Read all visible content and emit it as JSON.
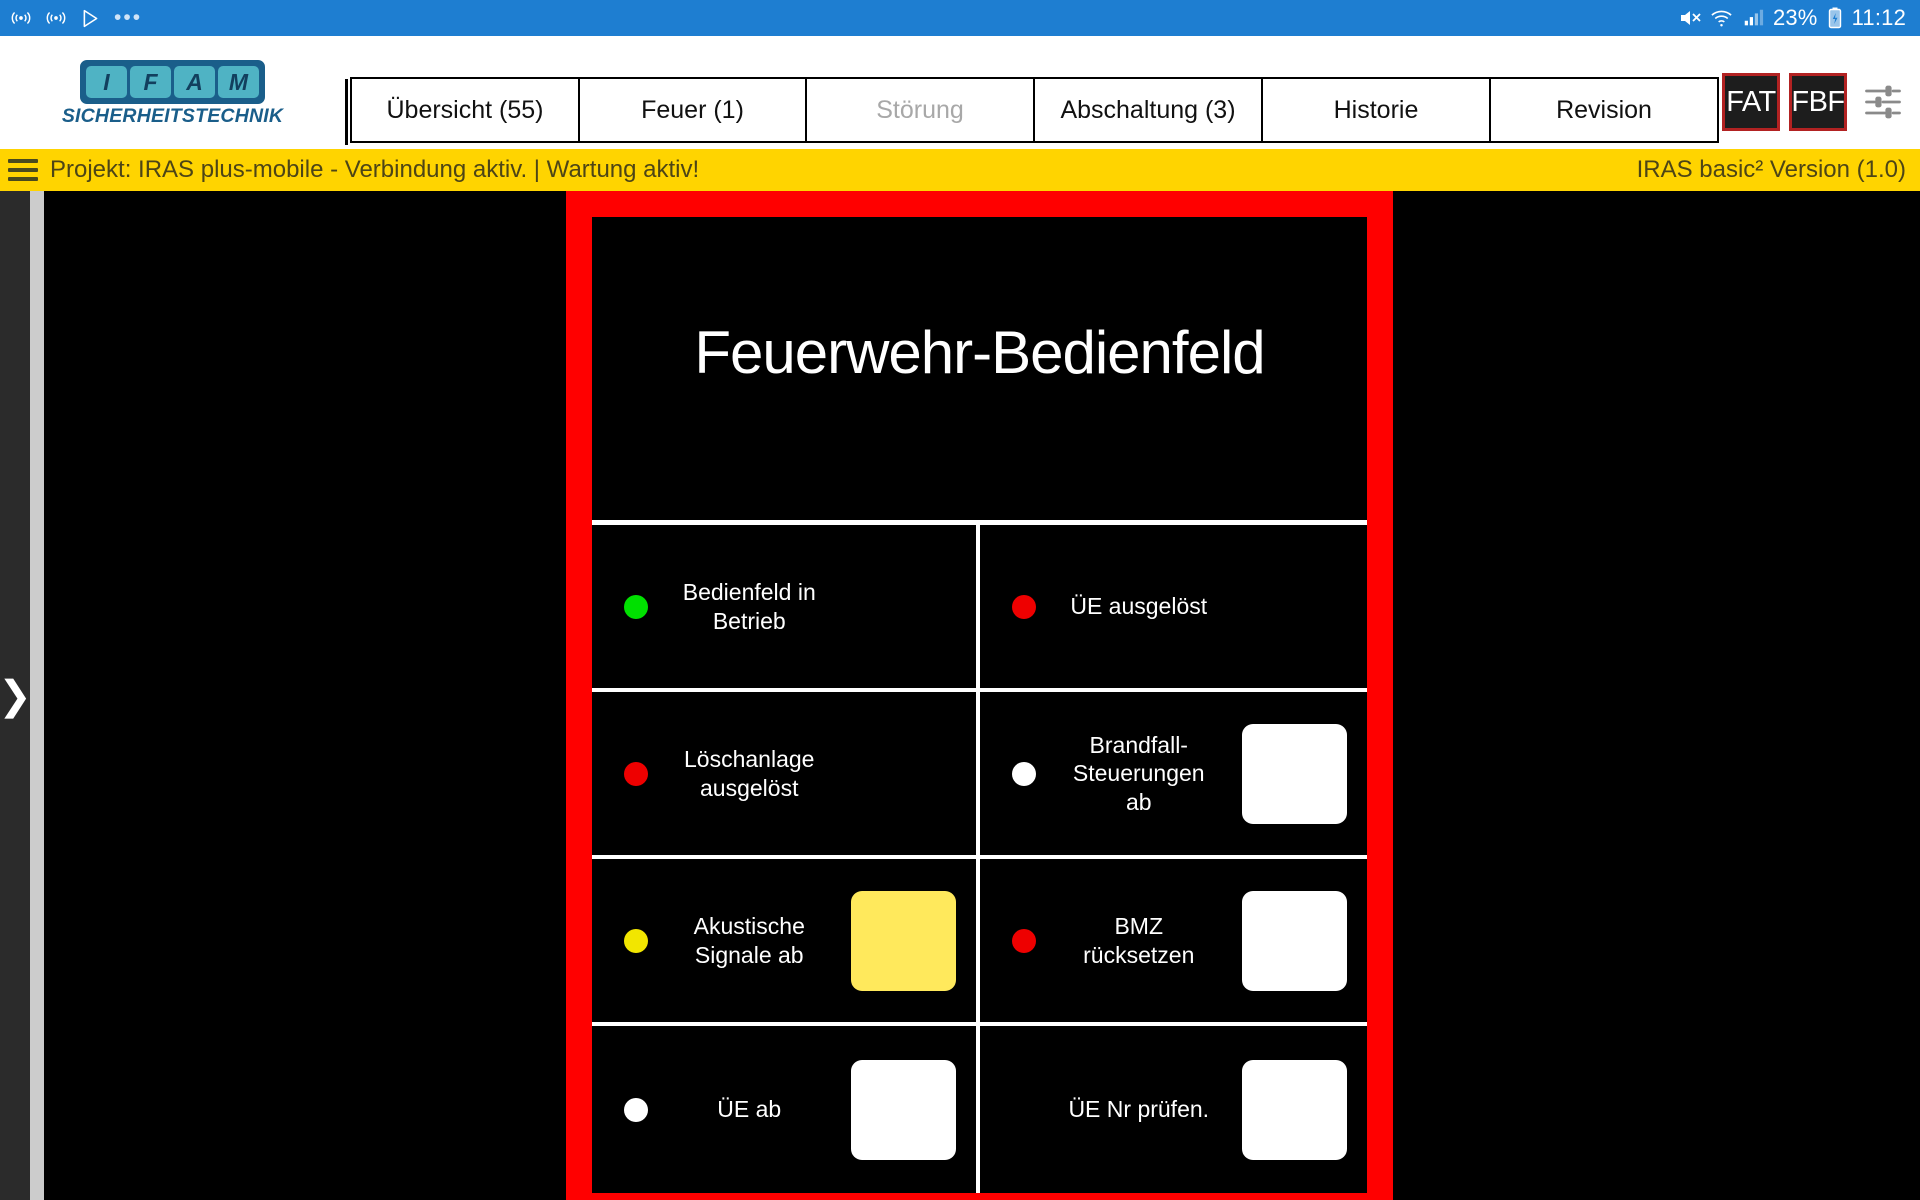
{
  "statusbar": {
    "left_icons": [
      "cast-icon",
      "cast-icon",
      "play-store-icon",
      "more-dots-icon"
    ],
    "dots": "•••",
    "mute_icon": "mute-icon",
    "wifi_icon": "wifi-icon",
    "signal_icon": "cell-signal-icon",
    "battery_percent": "23%",
    "battery_icon": "battery-charging-icon",
    "clock": "11:12"
  },
  "header": {
    "logo": {
      "letters": [
        "I",
        "F",
        "A",
        "M"
      ],
      "subtitle": "SICHERHEITSTECHNIK"
    },
    "tabs": [
      {
        "label": "Übersicht (55)",
        "disabled": false
      },
      {
        "label": "Feuer (1)",
        "disabled": false
      },
      {
        "label": "Störung",
        "disabled": true
      },
      {
        "label": "Abschaltung (3)",
        "disabled": false
      },
      {
        "label": "Historie",
        "disabled": false
      },
      {
        "label": "Revision",
        "disabled": false
      }
    ],
    "fat_label": "FAT",
    "fbf_label": "FBF",
    "settings_icon": "tune-sliders-icon"
  },
  "projectbar": {
    "menu_icon": "hamburger-menu-icon",
    "text": "Projekt:  IRAS plus-mobile  -  Verbindung aktiv. | Wartung aktiv!",
    "version": "IRAS basic² Version (1.0)"
  },
  "sidebar": {
    "expand_icon": "chevron-right-icon"
  },
  "panel": {
    "title": "Feuerwehr-Bedienfeld",
    "frame_color": "#ff0000",
    "cells": [
      {
        "led": "green",
        "label": "Bedienfeld in\nBetrieb",
        "label_line1": "Bedienfeld in",
        "label_line2": "Betrieb",
        "button": "none"
      },
      {
        "led": "red",
        "label": "ÜE ausgelöst",
        "label_line1": "ÜE ausgelöst",
        "label_line2": "",
        "button": "none"
      },
      {
        "led": "red",
        "label": "Löschanlage\nausgelöst",
        "label_line1": "Löschanlage",
        "label_line2": "ausgelöst",
        "button": "none"
      },
      {
        "led": "white",
        "label": "Brandfall-\nSteuerungen\nab",
        "label_line1": "Brandfall-",
        "label_line2": "Steuerungen",
        "label_line3": "ab",
        "button": "white"
      },
      {
        "led": "yellow",
        "label": "Akustische\nSignale ab",
        "label_line1": "Akustische",
        "label_line2": "Signale ab",
        "button": "yellow"
      },
      {
        "led": "red",
        "label": "BMZ\nrücksetzen",
        "label_line1": "BMZ",
        "label_line2": "rücksetzen",
        "button": "white"
      },
      {
        "led": "white",
        "label": "ÜE ab",
        "label_line1": "ÜE ab",
        "label_line2": "",
        "button": "white"
      },
      {
        "led": "none",
        "label": "ÜE Nr prüfen.",
        "label_line1": "ÜE Nr prüfen.",
        "label_line2": "",
        "button": "white"
      }
    ]
  },
  "colors": {
    "accent_blue": "#1e7ed1",
    "project_yellow": "#ffd400",
    "alarm_red": "#ff0000",
    "led_green": "#00e000",
    "led_yellow": "#f2e600"
  }
}
